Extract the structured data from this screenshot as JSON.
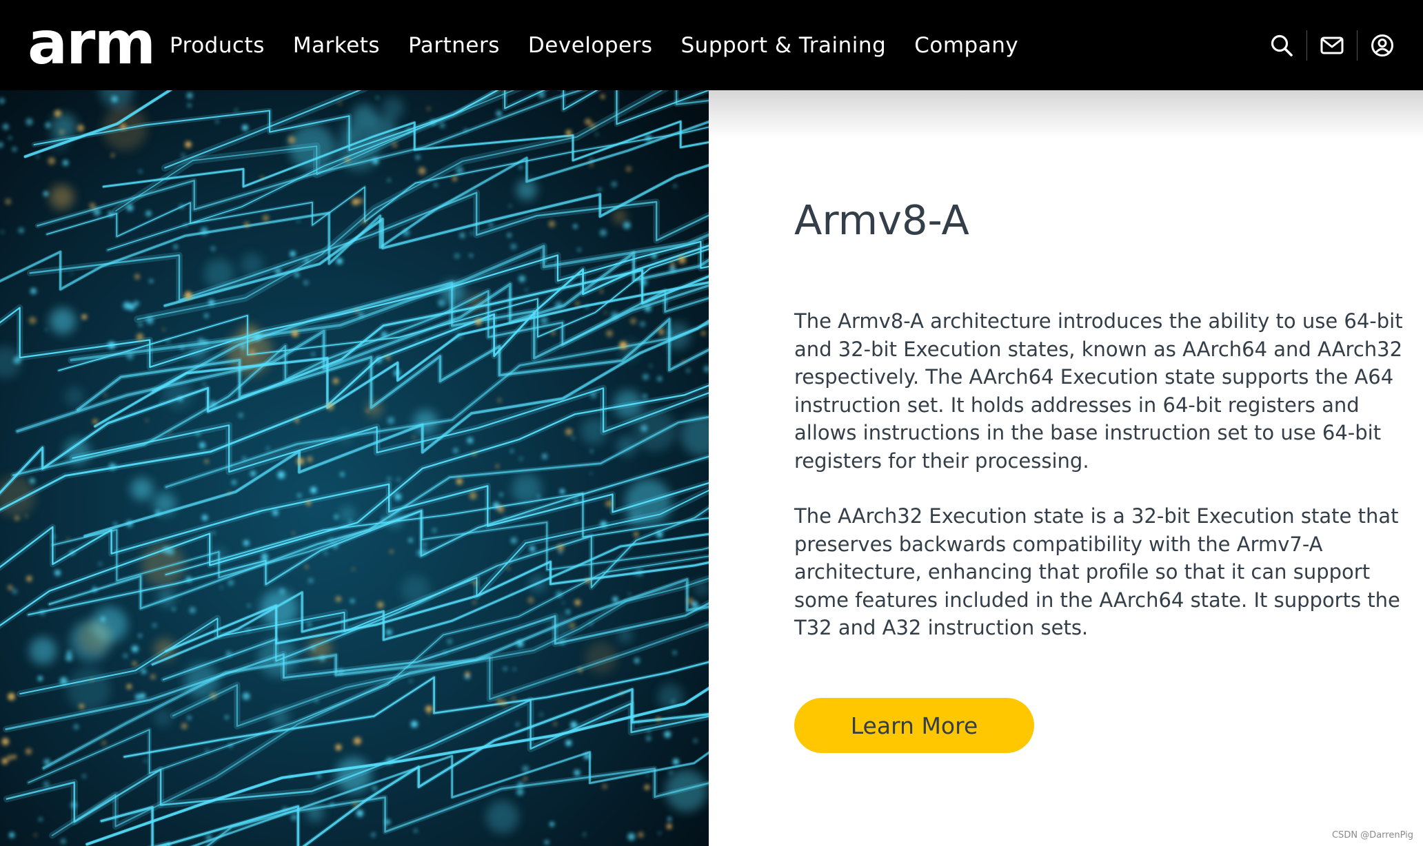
{
  "nav": {
    "logo": "arm",
    "links": [
      "Products",
      "Markets",
      "Partners",
      "Developers",
      "Support & Training",
      "Company"
    ],
    "icons": [
      "search-icon",
      "mail-icon",
      "account-icon"
    ]
  },
  "hero_image": {
    "subject": "circuit-board",
    "colors": {
      "background": "#031722",
      "trace": "#56e1ff",
      "light_gold": "#e2b158"
    }
  },
  "content": {
    "title": "Armv8-A",
    "paragraphs": [
      "The Armv8-A architecture introduces the ability to use 64-bit and 32-bit Execution states, known as AArch64 and AArch32 respectively. The AArch64 Execution state supports the A64 instruction set. It holds addresses in 64-bit registers and allows instructions in the base instruction set to use 64-bit registers for their processing.",
      "The AArch32 Execution state is a 32-bit Execution state that preserves backwards compatibility with the Armv7-A architecture, enhancing that profile so that it can support some features included in the AArch64 state. It supports the T32 and A32 instruction sets."
    ],
    "button_label": "Learn More"
  },
  "colors": {
    "nav_bg": "#000000",
    "text": "#333e48",
    "button": "#ffc700"
  },
  "watermark": "CSDN @DarrenPig"
}
